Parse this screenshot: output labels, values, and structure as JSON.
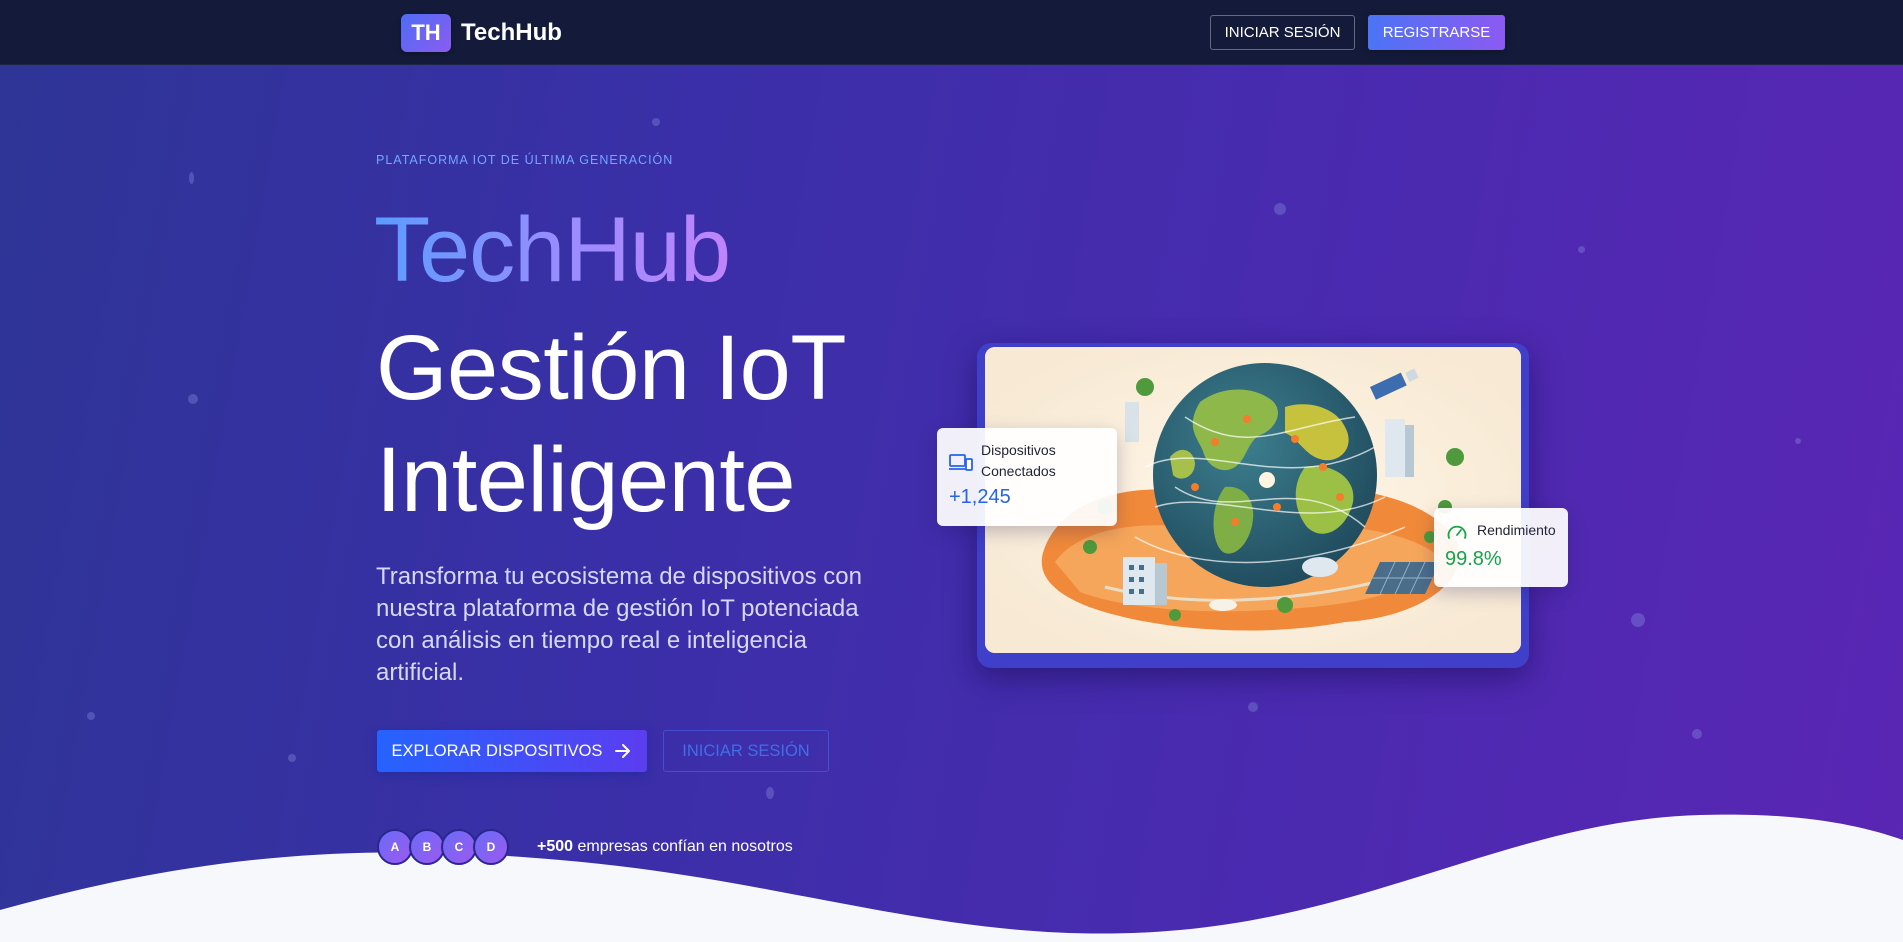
{
  "nav": {
    "brand_mark": "TH",
    "brand_name": "TechHub",
    "login_label": "INICIAR SESIÓN",
    "register_label": "REGISTRARSE"
  },
  "hero": {
    "eyebrow": "PLATAFORMA IOT DE ÚLTIMA GENERACIÓN",
    "title_brand": "TechHub",
    "title_line1": "Gestión IoT",
    "title_line2": "Inteligente",
    "subtitle": "Transforma tu ecosistema de dispositivos con nuestra plataforma de gestión IoT potenciada con análisis en tiempo real e inteligencia artificial.",
    "primary_cta": "EXPLORAR DISPOSITIVOS",
    "secondary_cta": "INICIAR SESIÓN",
    "avatars": [
      "A",
      "B",
      "C",
      "D"
    ],
    "trust_count": "+500",
    "trust_text": "empresas confían en nosotros"
  },
  "stats": {
    "devices_label": "Dispositivos Conectados",
    "devices_value": "+1,245",
    "performance_label": "Rendimiento",
    "performance_value": "99.8%"
  },
  "icons": {
    "devices": "devices-icon",
    "performance": "speedometer-icon",
    "arrow": "arrow-right-icon"
  },
  "colors": {
    "nav_bg": "#141b3a",
    "accent_blue": "#2563eb",
    "accent_purple": "#8c5af2",
    "success": "#16a34a"
  }
}
